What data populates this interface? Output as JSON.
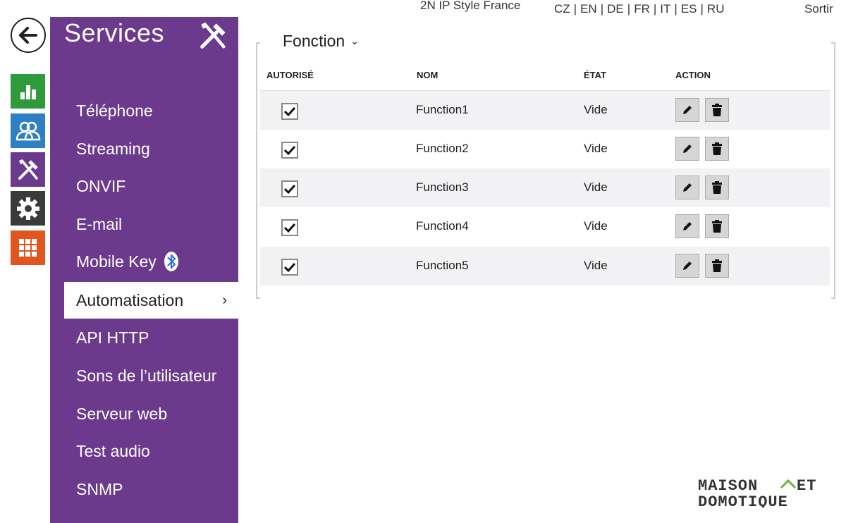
{
  "header": {
    "device_name": "2N IP Style France",
    "languages": [
      "CZ",
      "EN",
      "DE",
      "FR",
      "IT",
      "ES",
      "RU"
    ],
    "logout_label": "Sortir"
  },
  "rail": {
    "icons": [
      {
        "name": "back-arrow-icon",
        "color": "#222222"
      },
      {
        "name": "status-chart-icon",
        "color": "#2e9a3b"
      },
      {
        "name": "directory-users-icon",
        "color": "#2f7fc4"
      },
      {
        "name": "services-tools-icon",
        "color": "#6b3a8c"
      },
      {
        "name": "hardware-gear-icon",
        "color": "#3a3a3a"
      },
      {
        "name": "system-grid-icon",
        "color": "#e0561e"
      }
    ]
  },
  "sidebar": {
    "title": "Services",
    "color": "#6b3a8c",
    "items": [
      {
        "label": "Téléphone"
      },
      {
        "label": "Streaming"
      },
      {
        "label": "ONVIF"
      },
      {
        "label": "E-mail"
      },
      {
        "label": "Mobile Key",
        "icon": "bluetooth-icon"
      },
      {
        "label": "Automatisation",
        "active": true
      },
      {
        "label": "API HTTP"
      },
      {
        "label": "Sons de l’utilisateur"
      },
      {
        "label": "Serveur web"
      },
      {
        "label": "Test audio"
      },
      {
        "label": "SNMP"
      }
    ]
  },
  "main": {
    "section_title": "Fonction",
    "columns": [
      "AUTORISÉ",
      "NOM",
      "ÉTAT",
      "ACTION"
    ],
    "rows": [
      {
        "enabled": true,
        "name": "Function1",
        "state": "Vide"
      },
      {
        "enabled": true,
        "name": "Function2",
        "state": "Vide"
      },
      {
        "enabled": true,
        "name": "Function3",
        "state": "Vide"
      },
      {
        "enabled": true,
        "name": "Function4",
        "state": "Vide"
      },
      {
        "enabled": true,
        "name": "Function5",
        "state": "Vide"
      }
    ]
  },
  "watermark": {
    "line1": "MAISON ET",
    "line2": "DOMOTIQUE",
    "accent": "#6bb33a"
  }
}
